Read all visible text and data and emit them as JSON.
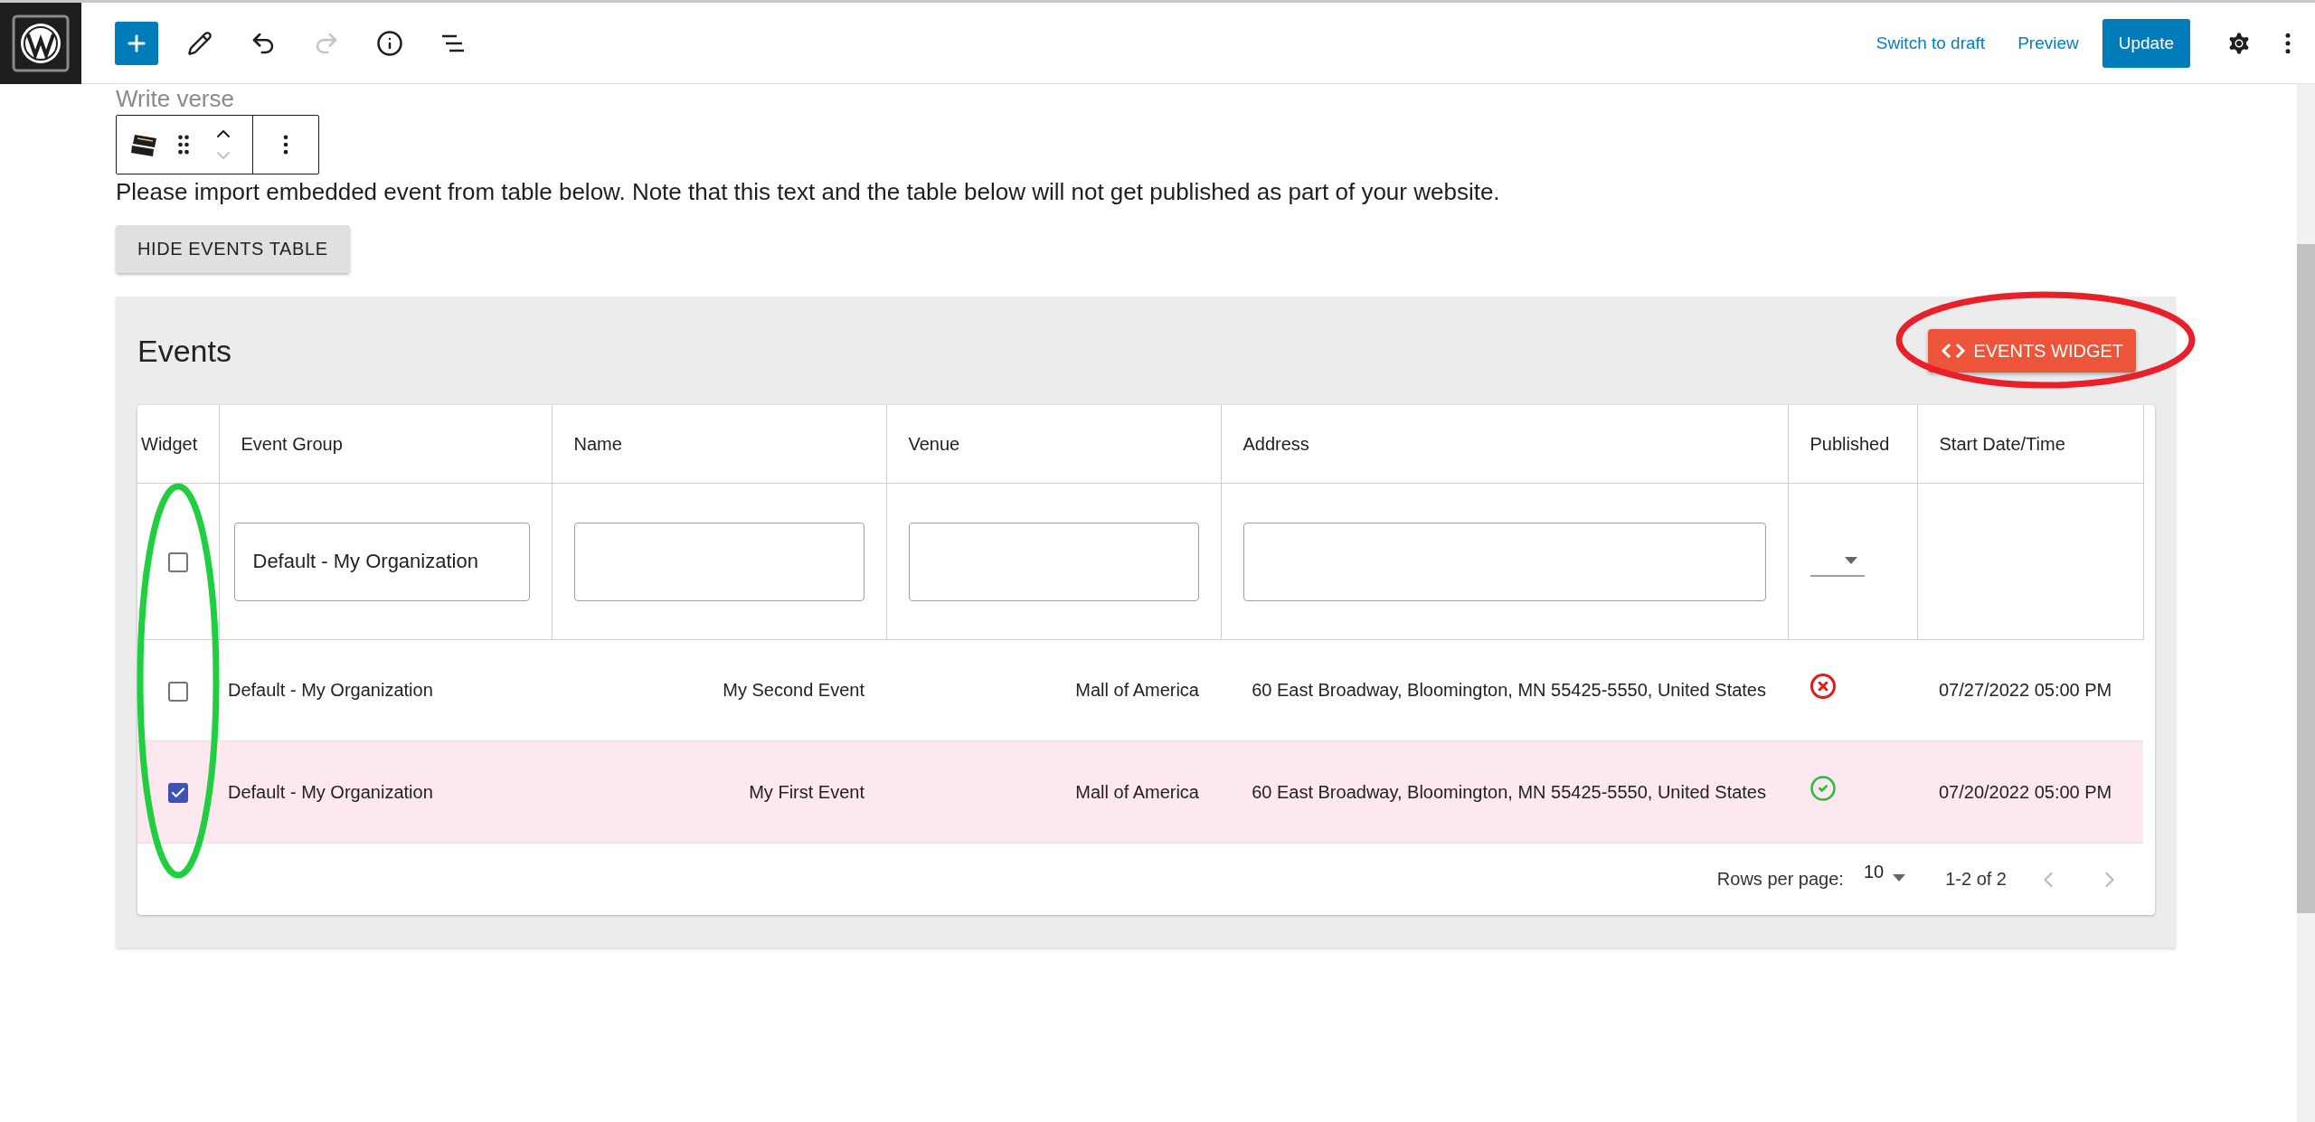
{
  "toolbar_tools": [
    {
      "kind": "add",
      "disabled": false
    },
    {
      "kind": "edit",
      "disabled": false
    },
    {
      "kind": "undo",
      "disabled": false
    },
    {
      "kind": "redo",
      "disabled": true
    },
    {
      "kind": "info",
      "disabled": false
    },
    {
      "kind": "outline",
      "disabled": false
    }
  ],
  "actions": {
    "switch_to_draft": "Switch to draft",
    "preview": "Preview",
    "update": "Update"
  },
  "editor": {
    "placeholder": "Write verse",
    "notice": "Please import embedded event from table below. Note that this text and the table below will not get published as part of your website.",
    "toggle_button": "HIDE EVENTS TABLE"
  },
  "block_toolbar": {
    "move_up": {
      "disabled": false
    },
    "move_down": {
      "disabled": true
    }
  },
  "events": {
    "title": "Events",
    "widget_button": "EVENTS WIDGET",
    "columns": [
      "Widget",
      "Event Group",
      "Name",
      "Venue",
      "Address",
      "Published",
      "Start Date/Time"
    ],
    "filters": {
      "checked": false,
      "event_group": "Default - My Organization"
    },
    "rows": [
      {
        "selected": false,
        "event_group": "Default - My Organization",
        "name": "My Second Event",
        "venue": "Mall of America",
        "address": "60 East Broadway, Bloomington, MN 55425-5550, United States",
        "published": false,
        "start": "07/27/2022 05:00 PM"
      },
      {
        "selected": true,
        "event_group": "Default - My Organization",
        "name": "My First Event",
        "venue": "Mall of America",
        "address": "60 East Broadway, Bloomington, MN 55425-5550, United States",
        "published": true,
        "start": "07/20/2022 05:00 PM"
      }
    ],
    "pagination": {
      "rows_per_page_label": "Rows per page:",
      "rows_per_page": "10",
      "range": "1-2 of 2",
      "previous_disabled": true,
      "next_disabled": true
    }
  },
  "annotations": [
    {
      "kind": "ellipse",
      "color": "#e8202a"
    },
    {
      "kind": "ellipse",
      "color": "#1fcf3f"
    }
  ]
}
